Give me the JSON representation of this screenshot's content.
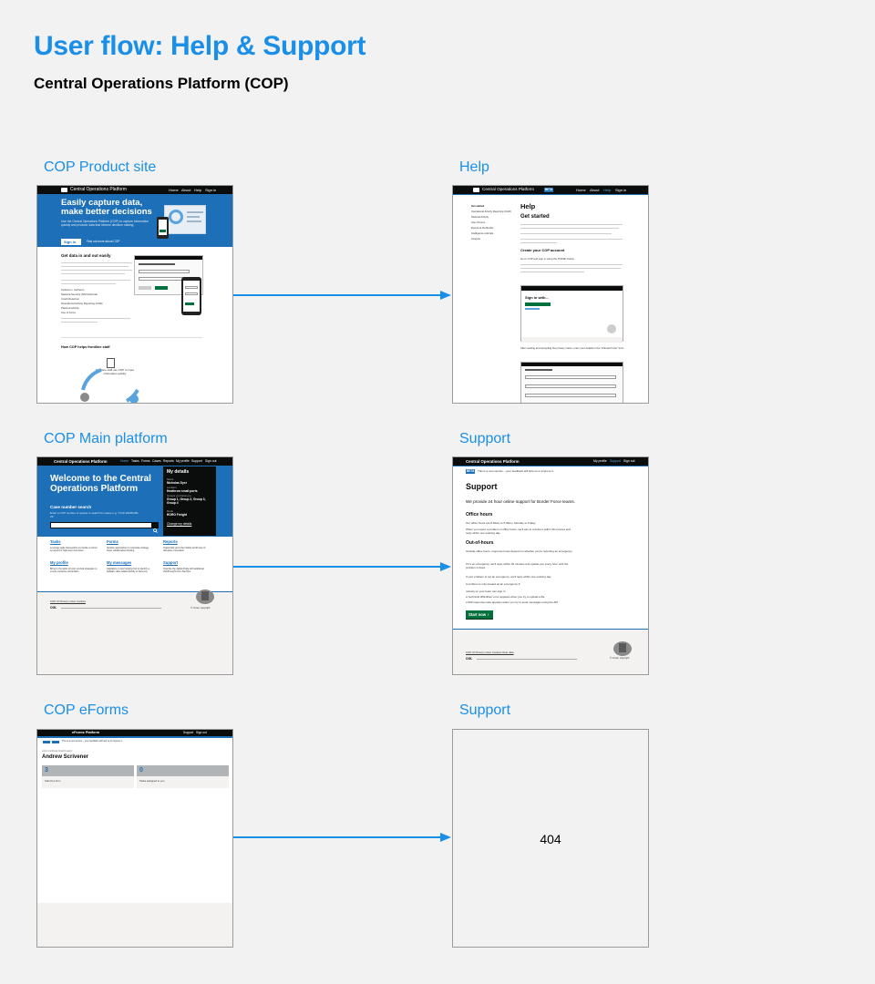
{
  "page": {
    "title": "User flow: Help & Support",
    "subtitle": "Central Operations Platform (COP)"
  },
  "rows": [
    {
      "left_label": "COP Product site",
      "right_label": "Help"
    },
    {
      "left_label": "COP Main platform",
      "right_label": "Support"
    },
    {
      "left_label": "COP eForms",
      "right_label": "Support"
    }
  ],
  "product_site": {
    "header_brand": "Central Operations Platform",
    "nav": [
      "Home",
      "About",
      "Help",
      "Sign in"
    ],
    "hero_title": "Easily capture data, make better decisions",
    "hero_text": "Use the Central Operations Platform (COP) to capture information quickly and produce data that informs decision making.",
    "sign_in": "Sign in",
    "find_out": "Find out more about COP",
    "section_title": "Get data in and out easily",
    "list_items": [
      "Cerberus / Cerberus",
      "National Security (NS) Referrals",
      "Crash Detection",
      "Operational Activity Reporting (OAR)",
      "Planned Activity",
      "Use of Force"
    ],
    "section2": "How COP helps frontline staff",
    "flow_text": "Frontline staff use COP to input information quickly"
  },
  "help_page": {
    "header_brand": "Central Operations Platform",
    "beta": "BETA",
    "nav": [
      "Home",
      "About",
      "Help",
      "Sign in"
    ],
    "sidebar": [
      "Get started",
      "Operational Activity Reporting (OAR)",
      "Planned Activity",
      "Use of Force",
      "Events at the Border",
      "Intelligence referrals",
      "Analysis"
    ],
    "h1": "Help",
    "h2": "Get started",
    "h3": "Create your COP account",
    "step1": "Go to COP and sign in using the 'POISE' button.",
    "mini_signin": "Sign in with...",
    "step2": "After reading and accepting the privacy notice, enter your details in the 'Onboard User' form."
  },
  "main_platform": {
    "header_brand": "Central Operations Platform",
    "nav": [
      "Home",
      "Tasks",
      "Forms",
      "Cases",
      "Reports",
      "My profile",
      "Support",
      "Sign out"
    ],
    "hero_title": "Welcome to the Central Operations Platform",
    "case_search": "Case number search",
    "case_hint": "Enter a COP number or quotes to search for cases e.g. \"COP-20220409-23\"",
    "details_title": "My details",
    "details": [
      {
        "k": "Name",
        "v": "Nicholas Dyer"
      },
      {
        "k": "Location",
        "v": "Heathrow small ports"
      },
      {
        "k": "Groups you belong to",
        "v": "Group 1, Group 2, Group 3, Group 4"
      },
      {
        "k": "Mode",
        "v": "RORO Freight"
      }
    ],
    "change_details": "Change my details",
    "tiles": [
      {
        "title": "Tasks",
        "text": "Leverage agile frameworks to provide a robust synopsis for high level overviews."
      },
      {
        "title": "Forms",
        "text": "Iterative approaches to corporate strategy foster collaborative thinking."
      },
      {
        "title": "Reports",
        "text": "Organically grow the holistic world view of disruptive innovation."
      },
      {
        "title": "My profile",
        "text": "Bring to the table win-win survival strategies to ensure proactive domination."
      },
      {
        "title": "My messages",
        "text": "Capitalize on low hanging fruit to identify a ballpark value added activity to beta test."
      },
      {
        "title": "Support",
        "text": "Override the digital divide with additional clickthroughs from DevOps."
      }
    ],
    "footer_links": "COP-UI Privacy notice  Cookies",
    "ogl": "OGL",
    "copyright": "© Crown copyright"
  },
  "support_page": {
    "header_brand": "Central Operations Platform",
    "nav": [
      "My profile",
      "Support",
      "Sign out"
    ],
    "beta": "BETA",
    "beta_text": "This is a new service – your feedback will help us to improve it.",
    "h1": "Support",
    "intro": "We provide 24 hour online support for Border Force teams.",
    "office_hours_title": "Office hours",
    "office_hours": "Our office hours are 8.30am to 5.30pm, Monday to Friday.",
    "office_hours2": "When you report a problem in office hours, we'll aim to resolve it within 30 minutes and reply within one working day.",
    "out_of_hours_title": "Out-of-hours",
    "out_of_hours": "Outside office hours, response times depend on whether you're reporting an emergency.",
    "out_of_hours2": "If it's an emergency, we'll reply within 30 minutes and update you every hour until the problem is fixed.",
    "out_of_hours3": "If your problem is not an emergency, we'll reply within one working day.",
    "emergency_title": "A problem is only treated as an emergency if:",
    "emergency_items": [
      "nobody on your team can sign in",
      "a 'technical difficulties' error appears when you try to upload a file",
      "a 500 response code appears when you try to send messages using the API"
    ],
    "start_now": "Start now",
    "footer_links": "COP-UI Privacy notice  Cookies  Clear data",
    "ogl": "OGL",
    "copyright": "© Crown copyright"
  },
  "eforms": {
    "header_brand": "eForms Platform",
    "nav": [
      "Support",
      "Sign out"
    ],
    "beta_text": "This is a new service – your feedback will help us to improve it.",
    "caption": "eForms/Data Dashboard",
    "user": "Andrew Scrivener",
    "panels": [
      {
        "count": "3",
        "label": "Submit a form"
      },
      {
        "count": "0",
        "label": "Tasks assigned to you"
      }
    ]
  },
  "not_found": {
    "text": "404"
  },
  "colors": {
    "title": "#1a8fe8",
    "arrow": "#1a8fe8",
    "header_black": "#0b0c0c",
    "hero_blue": "#1d70b8",
    "green": "#00703c"
  }
}
